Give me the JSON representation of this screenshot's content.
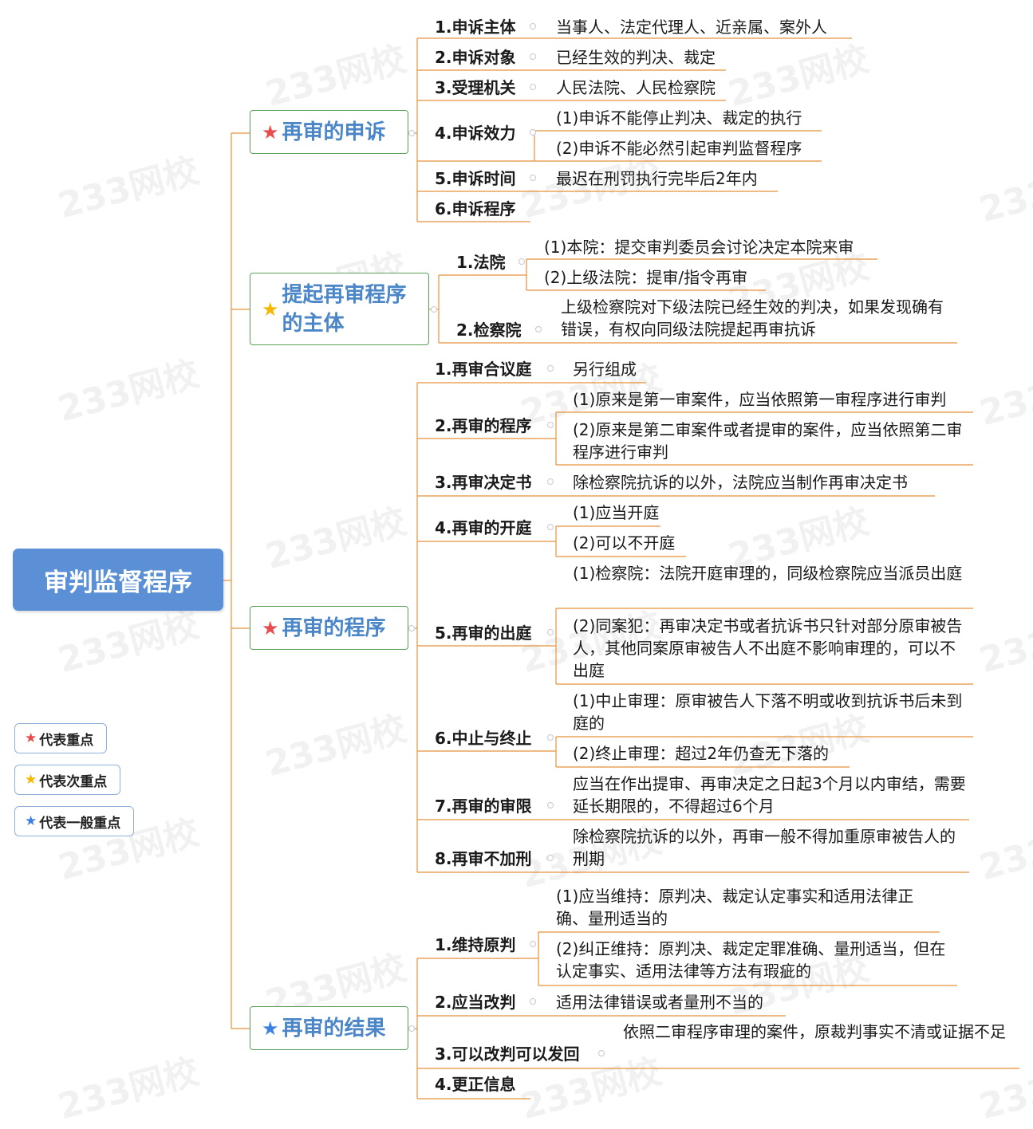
{
  "root": {
    "label": "审判监督程序"
  },
  "colors": {
    "root": "#5b8fd6",
    "branch_text": "#4a86c8",
    "branch_border": "#5aa05a",
    "line": "#e8913a",
    "star_key": "#e84c4c",
    "star_secondary": "#f5b800",
    "star_general": "#3b82e0"
  },
  "branches": [
    {
      "label": "再审的申诉",
      "star": "key"
    },
    {
      "label1": "提起再审程序",
      "label2": "的主体",
      "star": "secondary"
    },
    {
      "label": "再审的程序",
      "star": "key"
    },
    {
      "label": "再审的结果",
      "star": "general"
    }
  ],
  "b1": {
    "n1": {
      "label": "1.申诉主体",
      "d": "当事人、法定代理人、近亲属、案外人"
    },
    "n2": {
      "label": "2.申诉对象",
      "d": "已经生效的判决、裁定"
    },
    "n3": {
      "label": "3.受理机关",
      "d": "人民法院、人民检察院"
    },
    "n4": {
      "label": "4.申诉效力",
      "d1": "(1)申诉不能停止判决、裁定的执行",
      "d2": "(2)申诉不能必然引起审判监督程序"
    },
    "n5": {
      "label": "5.申诉时间",
      "d": "最迟在刑罚执行完毕后2年内"
    },
    "n6": {
      "label": "6.申诉程序"
    }
  },
  "b2": {
    "n1": {
      "label": "1.法院",
      "d1": "(1)本院：提交审判委员会讨论决定本院来审",
      "d2": "(2)上级法院：提审/指令再审"
    },
    "n2": {
      "label": "2.检察院",
      "d": "上级检察院对下级法院已经生效的判决，如果发现确有错误，有权向同级法院提起再审抗诉"
    }
  },
  "b3": {
    "n1": {
      "label": "1.再审合议庭",
      "d": "另行组成"
    },
    "n2": {
      "label": "2.再审的程序",
      "d1": "(1)原来是第一审案件，应当依照第一审程序进行审判",
      "d2": "(2)原来是第二审案件或者提审的案件，应当依照第二审程序进行审判"
    },
    "n3": {
      "label": "3.再审决定书",
      "d": "除检察院抗诉的以外，法院应当制作再审决定书"
    },
    "n4": {
      "label": "4.再审的开庭",
      "d1": "(1)应当开庭",
      "d2": "(2)可以不开庭"
    },
    "n5": {
      "label": "5.再审的出庭",
      "d1": "(1)检察院：法院开庭审理的，同级检察院应当派员出庭",
      "d2": "(2)同案犯：再审决定书或者抗诉书只针对部分原审被告人，其他同案原审被告人不出庭不影响审理的，可以不出庭"
    },
    "n6": {
      "label": "6.中止与终止",
      "d1": "(1)中止审理：原审被告人下落不明或收到抗诉书后未到庭的",
      "d2": "(2)终止审理：超过2年仍查无下落的"
    },
    "n7": {
      "label": "7.再审的审限",
      "d": "应当在作出提审、再审决定之日起3个月以内审结，需要延长期限的，不得超过6个月"
    },
    "n8": {
      "label": "8.再审不加刑",
      "d": "除检察院抗诉的以外，再审一般不得加重原审被告人的刑期"
    }
  },
  "b4": {
    "n1": {
      "label": "1.维持原判",
      "d1": "(1)应当维持：原判决、裁定认定事实和适用法律正确、量刑适当的",
      "d2": "(2)纠正维持：原判决、裁定定罪准确、量刑适当，但在认定事实、适用法律等方法有瑕疵的"
    },
    "n2": {
      "label": "2.应当改判",
      "d": "适用法律错误或者量刑不当的"
    },
    "n3": {
      "label": "3.可以改判可以发回",
      "d": "依照二审程序审理的案件，原裁判事实不清或证据不足"
    },
    "n4": {
      "label": "4.更正信息"
    }
  },
  "legend": [
    {
      "label": "代表重点",
      "star": "key"
    },
    {
      "label": "代表次重点",
      "star": "secondary"
    },
    {
      "label": "代表一般重点",
      "star": "general"
    }
  ],
  "watermark": {
    "text": "233网校"
  }
}
